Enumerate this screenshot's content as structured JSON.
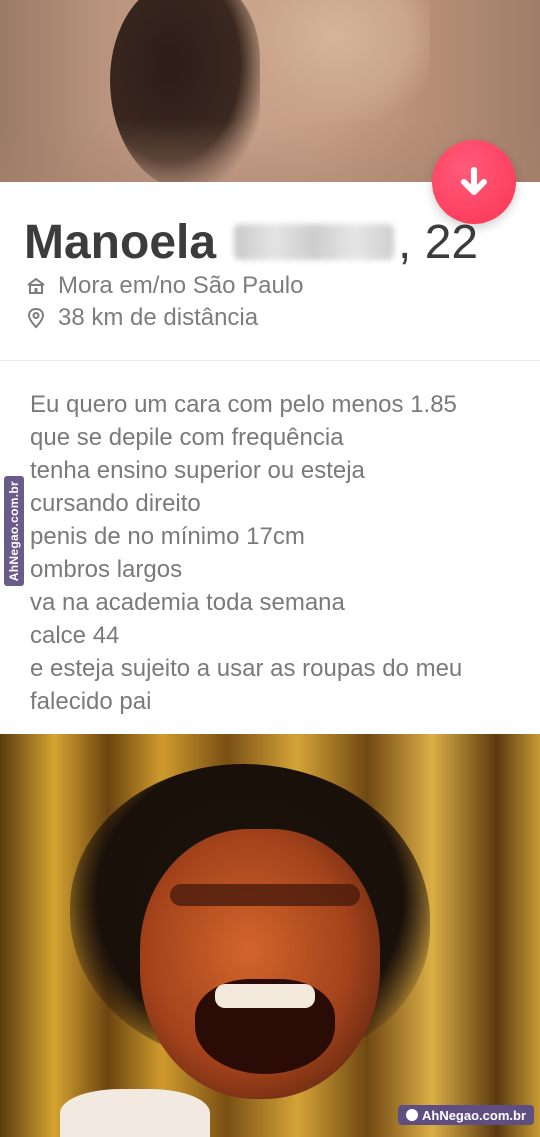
{
  "profile": {
    "name": "Manoela",
    "age": ", 22",
    "residence": "Mora em/no São Paulo",
    "distance": "38 km de distância"
  },
  "bio": {
    "lines": [
      "Eu quero um  cara com pelo menos 1.85",
      "que se depile com frequência",
      "tenha ensino superior ou esteja",
      "cursando direito",
      "penis de no mínimo 17cm",
      "ombros largos",
      "va na academia toda semana",
      "calce 44",
      "e esteja sujeito a usar as roupas do meu",
      "falecido pai"
    ]
  },
  "icons": {
    "home": "home-icon",
    "location": "location-pin-icon",
    "arrow": "arrow-down-icon"
  },
  "colors": {
    "accent": "#fd3f5f",
    "text": "#3c3c3c",
    "muted": "#7d7d7d",
    "watermark": "#5e4e82"
  },
  "watermark": {
    "side": "AhNegao.com.br",
    "bottom": "AhNegao.com.br"
  }
}
